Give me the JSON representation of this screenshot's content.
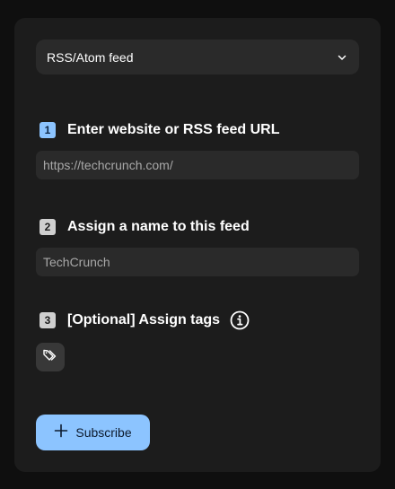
{
  "feed_type": {
    "selected": "RSS/Atom feed",
    "icon": "chevron-down-icon"
  },
  "steps": [
    {
      "number": "1",
      "label": "Enter website or RSS feed URL",
      "value": "https://techcrunch.com/"
    },
    {
      "number": "2",
      "label": "Assign a name to this feed",
      "value": "TechCrunch"
    },
    {
      "number": "3",
      "label": "[Optional] Assign tags",
      "info_icon": "info-icon",
      "tag_icon": "tag-icon"
    }
  ],
  "actions": {
    "subscribe_label": "Subscribe",
    "subscribe_icon": "plus-icon"
  },
  "colors": {
    "accent": "#8cc4ff",
    "panel": "#1c1c1c",
    "field": "#2a2a2a",
    "background": "#0f0f0f"
  }
}
